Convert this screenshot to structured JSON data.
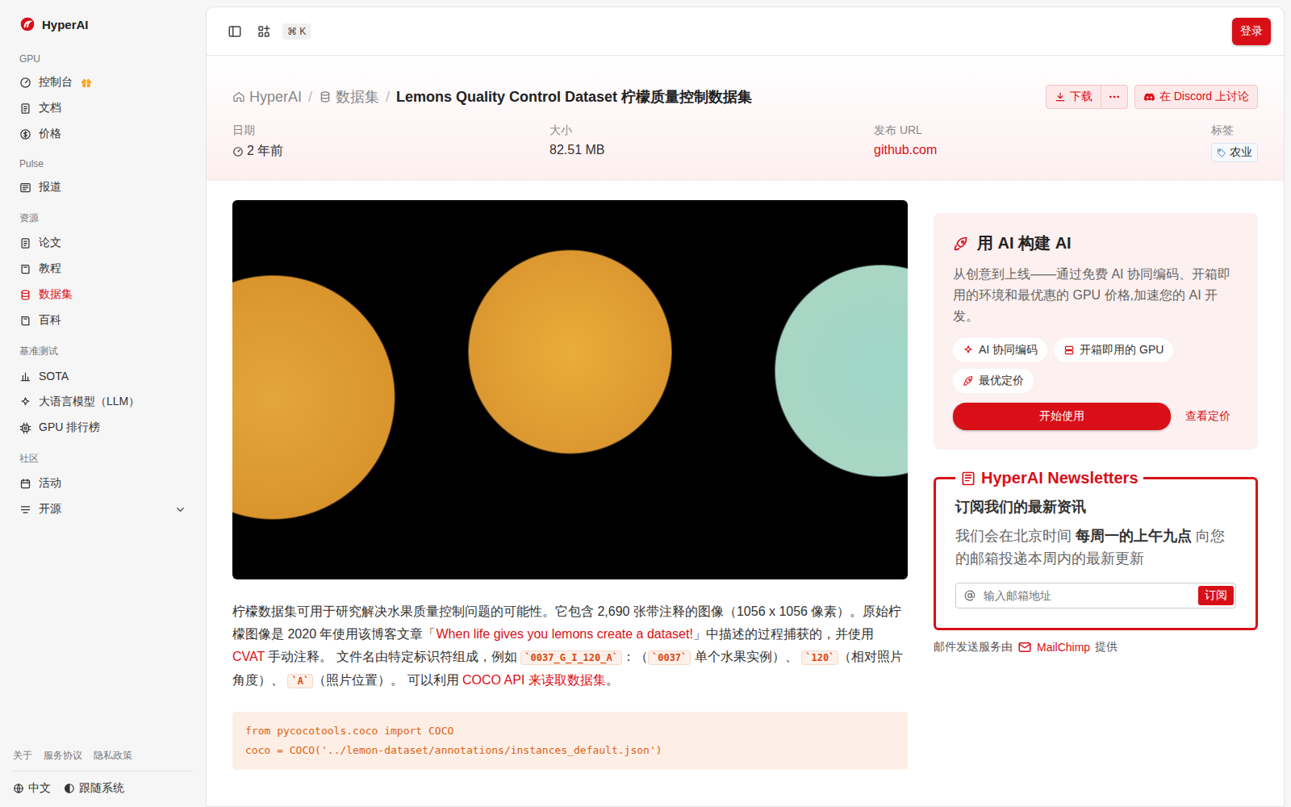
{
  "logo": {
    "text": "HyperAI"
  },
  "sidebar": {
    "sections": [
      {
        "title": "GPU",
        "items": [
          {
            "label": "控制台",
            "selected": false,
            "gift": true
          },
          {
            "label": "文档",
            "selected": false,
            "gift": false
          },
          {
            "label": "价格",
            "selected": false,
            "gift": false
          }
        ]
      },
      {
        "title": "Pulse",
        "items": [
          {
            "label": "报道",
            "selected": false,
            "gift": false
          }
        ]
      },
      {
        "title": "资源",
        "items": [
          {
            "label": "论文",
            "selected": false,
            "gift": false
          },
          {
            "label": "教程",
            "selected": false,
            "gift": false
          },
          {
            "label": "数据集",
            "selected": true,
            "gift": false
          },
          {
            "label": "百科",
            "selected": false,
            "gift": false
          }
        ]
      },
      {
        "title": "基准测试",
        "items": [
          {
            "label": "SOTA",
            "selected": false,
            "gift": false
          },
          {
            "label": "大语言模型（LLM）",
            "selected": false,
            "gift": false
          },
          {
            "label": "GPU 排行榜",
            "selected": false,
            "gift": false
          }
        ]
      },
      {
        "title": "社区",
        "items": [
          {
            "label": "活动",
            "selected": false,
            "gift": false
          },
          {
            "label": "开源",
            "selected": false,
            "gift": false,
            "expanded": false
          }
        ]
      }
    ],
    "footer_links": [
      "关于",
      "服务协议",
      "隐私政策"
    ],
    "language": "中文",
    "theme": "跟随系统"
  },
  "topbar": {
    "shortcut": "⌘ K",
    "login": "登录"
  },
  "breadcrumbs": {
    "separator": "/",
    "items": [
      "HyperAI",
      "数据集",
      "Lemons Quality Control Dataset 柠檬质量控制数据集"
    ]
  },
  "actions": {
    "download": "下载",
    "discord": "在 Discord 上讨论"
  },
  "meta": [
    {
      "label": "日期",
      "value": "2 年前",
      "kind": "time"
    },
    {
      "label": "大小",
      "value": "82.51 MB",
      "kind": "plain"
    },
    {
      "label": "发布 URL",
      "value": "github.com",
      "kind": "link"
    },
    {
      "label": "标签",
      "value": "农业",
      "kind": "tag"
    }
  ],
  "description": [
    {
      "kind": "text",
      "text": "柠檬数据集可用于研究解决水果质量控制问题的可能性。它包含 2,690 张带注释的图像（1056 x 1056 像素）。原始柠檬图像是 2020 年使用该博客文章「"
    },
    {
      "kind": "link",
      "text": "When life gives you lemons create a dataset!"
    },
    {
      "kind": "text",
      "text": "」中描述的过程捕获的，并使用 "
    },
    {
      "kind": "link",
      "text": "CVAT"
    },
    {
      "kind": "text",
      "text": " 手动注释。 文件名由特定标识符组成，例如 "
    },
    {
      "kind": "code",
      "text": "`0037_G_I_120_A`"
    },
    {
      "kind": "text",
      "text": "：（"
    },
    {
      "kind": "code",
      "text": "`0037`"
    },
    {
      "kind": "text",
      "text": " 单个水果实例）、 "
    },
    {
      "kind": "code",
      "text": "`120`"
    },
    {
      "kind": "text",
      "text": "（相对照片角度）、 "
    },
    {
      "kind": "code",
      "text": "`A`"
    },
    {
      "kind": "text",
      "text": "（照片位置）。 可以利用 "
    },
    {
      "kind": "link",
      "text": "COCO API 来读取数据集"
    },
    {
      "kind": "text",
      "text": "。"
    }
  ],
  "code": [
    "from pycocotools.coco import COCO",
    "coco = COCO('../lemon-dataset/annotations/instances_default.json')"
  ],
  "promo": {
    "title": "用 AI 构建 AI",
    "description": "从创意到上线——通过免费 AI 协同编码、开箱即用的环境和最优惠的 GPU 价格,加速您的 AI 开发。",
    "chips": [
      "AI 协同编码",
      "开箱即用的 GPU",
      "最优定价"
    ],
    "button": "开始使用",
    "link": "查看定价"
  },
  "newsletter": {
    "title": "HyperAI Newsletters",
    "subtitle": "订阅我们的最新资讯",
    "description": [
      {
        "kind": "text",
        "text": "我们会在北京时间 "
      },
      {
        "kind": "bold",
        "text": "每周一的上午九点"
      },
      {
        "kind": "text",
        "text": " 向您的邮箱投递本周内的最新更新"
      }
    ],
    "placeholder": "输入邮箱地址",
    "button": "订阅",
    "footer": [
      "邮件发送服务由 ",
      "MailChimp",
      " 提供"
    ]
  }
}
